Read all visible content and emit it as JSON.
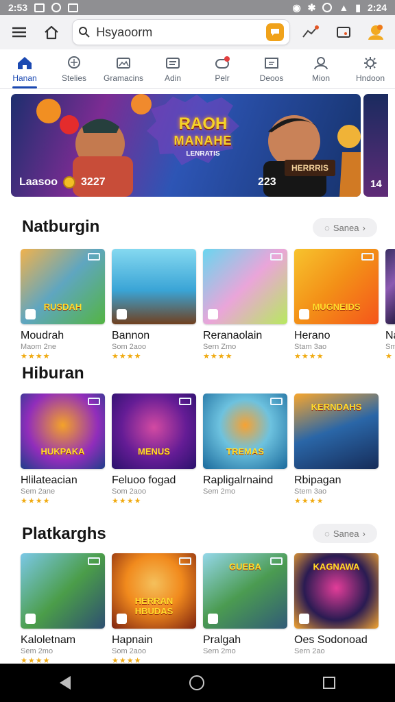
{
  "status": {
    "time_left": "2:53",
    "time_right": "2:24"
  },
  "toolbar": {
    "search_text": "Hsyaoorm"
  },
  "tabs": [
    {
      "label": "Hanan",
      "icon": "home-icon"
    },
    {
      "label": "Stelies",
      "icon": "search-icon"
    },
    {
      "label": "Gramacins",
      "icon": "image-icon"
    },
    {
      "label": "Adin",
      "icon": "list-icon"
    },
    {
      "label": "Pelr",
      "icon": "gamepad-icon"
    },
    {
      "label": "Deoos",
      "icon": "scan-icon"
    },
    {
      "label": "Mion",
      "icon": "user-icon"
    },
    {
      "label": "Hndoon",
      "icon": "gear-icon"
    }
  ],
  "hero": {
    "label": "Laasoo",
    "score": "3227",
    "count": "223",
    "title_top": "RAOH",
    "title_middle": "MANAHE",
    "title_bottom": "LENRATIS",
    "banner": "HERRRIS",
    "peek_count": "14"
  },
  "sections": [
    {
      "title": "Natburgin",
      "more_label": "Sanea",
      "items": [
        {
          "name": "Moudrah",
          "sub": "Maom 2ne",
          "stars": "★★★★",
          "label": "RUSDAH",
          "colors": [
            "#f0b24d",
            "#5fa6c0",
            "#54b443"
          ]
        },
        {
          "name": "Bannon",
          "sub": "Som 2aoo",
          "stars": "★★★★",
          "label": "",
          "colors": [
            "#85d9f0",
            "#3aa4d6",
            "#70401f"
          ]
        },
        {
          "name": "Reranaolain",
          "sub": "Sern Zmo",
          "stars": "★★★★",
          "label": "",
          "colors": [
            "#69d6ef",
            "#eaa5d9",
            "#b7e95e"
          ]
        },
        {
          "name": "Herano",
          "sub": "Stam 3ao",
          "stars": "★★★★",
          "label": "MUGNEIDS",
          "colors": [
            "#f7c32e",
            "#f39017",
            "#f5551b"
          ]
        },
        {
          "name": "Na",
          "sub": "Sm",
          "stars": "★",
          "label": "",
          "colors": [
            "#3a2f63",
            "#8c5ab2",
            "#251b42"
          ]
        }
      ]
    },
    {
      "title": "Hiburan",
      "more_label": "",
      "items": [
        {
          "name": "Hlilateacian",
          "sub": "Sem 2ane",
          "stars": "★★★★",
          "label": "HUKPAKA",
          "colors": [
            "#f4a229",
            "#912dbb",
            "#1f3e8a"
          ]
        },
        {
          "name": "Feluoo fogad",
          "sub": "Som 2aoo",
          "stars": "★★★★",
          "label": "MENUS",
          "colors": [
            "#641c95",
            "#d34aa2",
            "#2a126c"
          ]
        },
        {
          "name": "Rapligalrnaind",
          "sub": "Sem 2mo",
          "stars": "",
          "label": "TREMAS",
          "colors": [
            "#6dc2df",
            "#1b6a9c",
            "#f7a232"
          ]
        },
        {
          "name": "Rbipagan",
          "sub": "Stem 3ao",
          "stars": "★★★★",
          "label": "KERNDAHS",
          "colors": [
            "#f7a62e",
            "#2a66a7",
            "#162c59"
          ]
        }
      ]
    },
    {
      "title": "Platkarghs",
      "more_label": "Sanea",
      "items": [
        {
          "name": "Kaloletnam",
          "sub": "Sem 2mo",
          "stars": "★★★★",
          "label": "",
          "colors": [
            "#7bc8e7",
            "#4b9d49",
            "#2e4f71"
          ]
        },
        {
          "name": "Hapnain",
          "sub": "Som 2aoo",
          "stars": "★★★★",
          "label": "HERRAN HBUDAS",
          "colors": [
            "#f18a1d",
            "#7e2310",
            "#f4c05c"
          ]
        },
        {
          "name": "Pralgah",
          "sub": "Sern 2mo",
          "stars": "",
          "label": "GUEBA",
          "colors": [
            "#94d7e9",
            "#4b9b51",
            "#315b77"
          ]
        },
        {
          "name": "Oes Sodonoad",
          "sub": "Sern 2ao",
          "stars": "",
          "label": "KAGNAWA",
          "colors": [
            "#2a1b52",
            "#e33d99",
            "#f3a531"
          ]
        }
      ]
    }
  ]
}
